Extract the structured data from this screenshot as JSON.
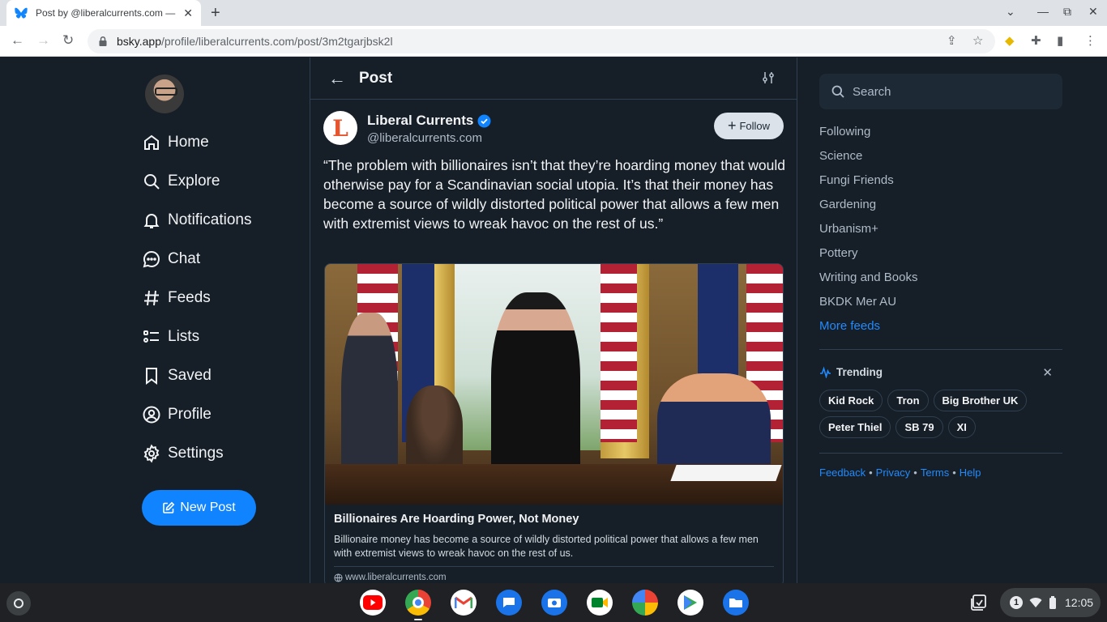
{
  "browser": {
    "tab_title": "Post by @liberalcurrents.com —",
    "url_host": "bsky.app",
    "url_path": "/profile/liberalcurrents.com/post/3m2tgarjbsk2l"
  },
  "nav": {
    "items": [
      {
        "label": "Home",
        "icon": "home-icon"
      },
      {
        "label": "Explore",
        "icon": "search-icon"
      },
      {
        "label": "Notifications",
        "icon": "bell-icon"
      },
      {
        "label": "Chat",
        "icon": "chat-icon"
      },
      {
        "label": "Feeds",
        "icon": "hash-icon"
      },
      {
        "label": "Lists",
        "icon": "list-icon"
      },
      {
        "label": "Saved",
        "icon": "bookmark-icon"
      },
      {
        "label": "Profile",
        "icon": "profile-icon"
      },
      {
        "label": "Settings",
        "icon": "gear-icon"
      }
    ],
    "new_post_label": "New Post"
  },
  "post": {
    "header_title": "Post",
    "author_name": "Liberal Currents",
    "author_handle": "@liberalcurrents.com",
    "avatar_letter": "L",
    "follow_label": "Follow",
    "text": "“The problem with billionaires isn’t that they’re hoarding money that would otherwise pay for a Scandinavian social utopia. It’s that their money has become a source of wildly distorted political power that allows a few men with extremist views to wreak havoc on the rest of us.”",
    "embed": {
      "title": "Billionaires Are Hoarding Power, Not Money",
      "description": "Billionaire money has become a source of wildly distorted political power that allows a few men with extremist views to wreak havoc on the rest of us.",
      "domain": "www.liberalcurrents.com"
    }
  },
  "right": {
    "search_placeholder": "Search",
    "feeds": [
      "Following",
      "Science",
      "Fungi Friends",
      "Gardening",
      "Urbanism+",
      "Pottery",
      "Writing and Books",
      "BKDK Mer AU"
    ],
    "more_feeds": "More feeds",
    "trending_label": "Trending",
    "trending": [
      "Kid Rock",
      "Tron",
      "Big Brother UK",
      "Peter Thiel",
      "SB 79",
      "XI"
    ],
    "footer": [
      "Feedback",
      "Privacy",
      "Terms",
      "Help"
    ]
  },
  "shelf": {
    "notification_count": "1",
    "time": "12:05"
  },
  "colors": {
    "background": "#161e27",
    "accent": "#1083fe",
    "link": "#208bfe"
  }
}
